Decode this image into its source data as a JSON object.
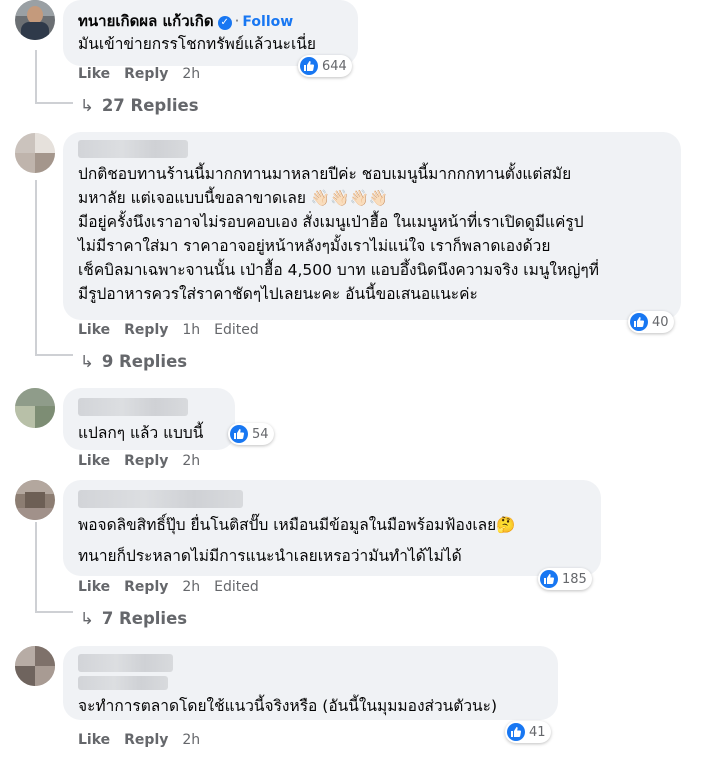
{
  "comments": [
    {
      "author": "ทนายเกิดผล แก้วเกิด",
      "follow_label": "Follow",
      "lines": [
        "มันเข้าข่ายกรรโชกทรัพย์แล้วนะเนี่ย"
      ],
      "reactions": "644",
      "like_label": "Like",
      "reply_label": "Reply",
      "time": "2h",
      "replies_label": "27 Replies"
    },
    {
      "lines": [
        "ปกติชอบทานร้านนี้มากกทานมาหลายปีค่ะ ชอบเมนูนี้มากกกทานตั้งแต่สมัย",
        "มหาลัย แต่เจอแบบนี้ขอลาขาดเลย 👋🏻👋🏻👋🏻👋🏻",
        "มีอยู่ครั้งนึงเราอาจไม่รอบคอบเอง สั่งเมนูเป่าฮื้อ ในเมนูหน้าที่เราเปิดดูมีแค่รูป",
        "ไม่มีราคาใส่มา ราคาอาจอยู่หน้าหลังๆมั้งเราไม่แน่ใจ เราก็พลาดเองด้วย",
        "เช็คบิลมาเฉพาะจานนั้น เป่าฮื้อ 4,500 บาท แอบอึ้งนิดนึงความจริง เมนูใหญ่ๆที่",
        "มีรูปอาหารควรใส่ราคาชัดๆไปเลยนะคะ อันนี้ขอเสนอแนะค่ะ"
      ],
      "reactions": "40",
      "like_label": "Like",
      "reply_label": "Reply",
      "time": "1h",
      "edited_label": "Edited",
      "replies_label": "9 Replies"
    },
    {
      "lines": [
        "แปลกๆ แล้ว แบบนี้"
      ],
      "reactions": "54",
      "like_label": "Like",
      "reply_label": "Reply",
      "time": "2h"
    },
    {
      "lines": [
        "พอจดลิขสิทธิ์ปุ๊บ ยื่นโนติสปั๊บ เหมือนมีข้อมูลในมือพร้อมฟ้องเลย🤔",
        "ทนายก็ประหลาดไม่มีการแนะนำเลยเหรอว่ามันทำได้ไม่ได้"
      ],
      "reactions": "185",
      "like_label": "Like",
      "reply_label": "Reply",
      "time": "2h",
      "edited_label": "Edited",
      "replies_label": "7 Replies"
    },
    {
      "lines": [
        "จะทำการตลาดโดยใช้แนวนี้จริงหรือ (อันนี้ในมุมมองส่วนตัวนะ)"
      ],
      "reactions": "41",
      "like_label": "Like",
      "reply_label": "Reply",
      "time": "2h"
    }
  ],
  "colors": {
    "bubble": "#f0f2f5",
    "link_blue": "#1877f2",
    "meta_gray": "#65676b"
  }
}
